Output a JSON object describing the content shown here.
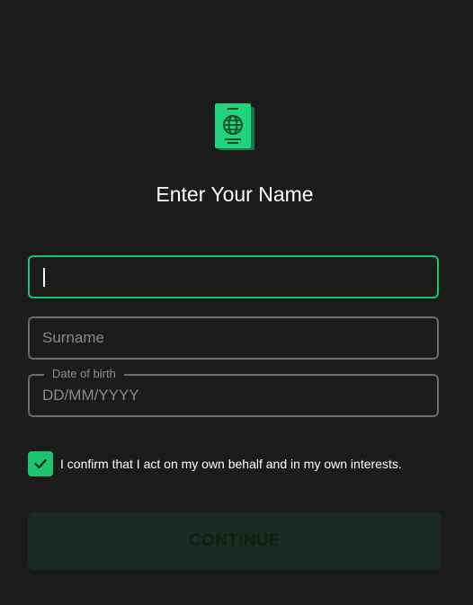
{
  "form": {
    "title": "Enter Your Name",
    "first_name": {
      "value": "",
      "placeholder": ""
    },
    "surname": {
      "value": "",
      "placeholder": "Surname"
    },
    "date_of_birth": {
      "label": "Date of birth",
      "value": "",
      "placeholder": "DD/MM/YYYY"
    },
    "confirm": {
      "checked": true,
      "label": "I confirm that I act on my own behalf and in my own interests."
    },
    "continue_label": "CONTINUE"
  },
  "icons": {
    "header": "passport-icon",
    "checkbox": "check-icon"
  },
  "colors": {
    "background": "#1b1b1b",
    "accent": "#1fc36f",
    "field_border": "#6b6b6b",
    "button_disabled_bg": "#182a21"
  }
}
